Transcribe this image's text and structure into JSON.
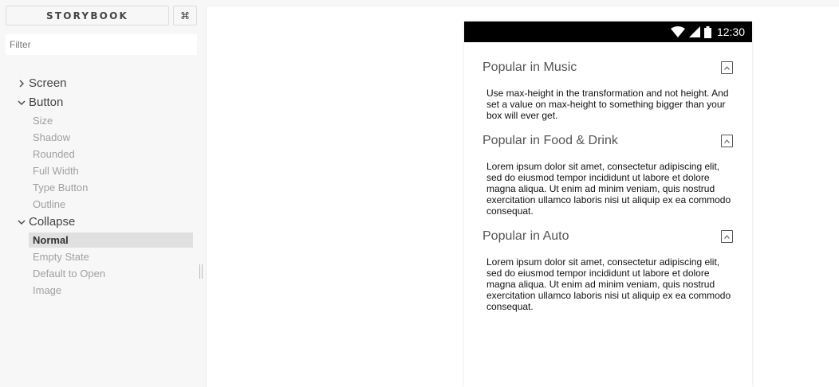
{
  "sidebar": {
    "brand": "STORYBOOK",
    "shortcut_icon": "command-icon",
    "shortcut_glyph": "⌘",
    "filter_placeholder": "Filter",
    "kinds": [
      {
        "label": "Screen",
        "expanded": false,
        "stories": []
      },
      {
        "label": "Button",
        "expanded": true,
        "stories": [
          "Size",
          "Shadow",
          "Rounded",
          "Full Width",
          "Type Button",
          "Outline"
        ]
      },
      {
        "label": "Collapse",
        "expanded": true,
        "stories": [
          "Normal",
          "Empty State",
          "Default to Open",
          "Image"
        ]
      }
    ],
    "active_story": "Normal"
  },
  "device": {
    "status_icons": [
      "wifi-icon",
      "signal-icon",
      "battery-icon"
    ],
    "time": "12:30",
    "sections": [
      {
        "title": "Popular in Music",
        "body": "Use max-height in the transformation and not height. And set a value on max-height to something bigger than your box will ever get."
      },
      {
        "title": "Popular in Food & Drink",
        "body": "Lorem ipsum dolor sit amet, consectetur adipiscing elit, sed do eiusmod tempor incididunt ut labore et dolore magna aliqua. Ut enim ad minim veniam, quis nostrud exercitation ullamco laboris nisi ut aliquip ex ea commodo consequat."
      },
      {
        "title": "Popular in Auto",
        "body": "Lorem ipsum dolor sit amet, consectetur adipiscing elit, sed do eiusmod tempor incididunt ut labore et dolore magna aliqua. Ut enim ad minim veniam, quis nostrud exercitation ullamco laboris nisi ut aliquip ex ea commodo consequat."
      }
    ]
  },
  "colors": {
    "sidebar_bg": "#f7f7f7",
    "active_story_bg": "#e0e0e0",
    "statusbar_bg": "#000000"
  }
}
